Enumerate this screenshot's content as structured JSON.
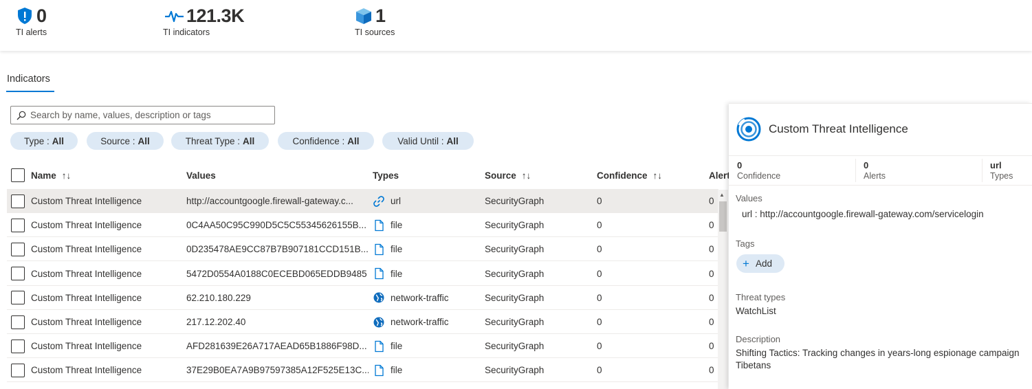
{
  "metrics": {
    "alerts": {
      "value": "0",
      "label": "TI alerts",
      "icon": "shield-alert-icon"
    },
    "indicators": {
      "value": "121.3K",
      "label": "TI indicators",
      "icon": "pulse-icon"
    },
    "sources": {
      "value": "1",
      "label": "TI sources",
      "icon": "cube-icon"
    }
  },
  "tab": {
    "label": "Indicators"
  },
  "search": {
    "placeholder": "Search by name, values, description or tags"
  },
  "filters": [
    {
      "label": "Type :",
      "value": "All"
    },
    {
      "label": "Source :",
      "value": "All"
    },
    {
      "label": "Threat Type :",
      "value": "All"
    },
    {
      "label": "Confidence :",
      "value": "All"
    },
    {
      "label": "Valid Until :",
      "value": "All"
    }
  ],
  "columns": {
    "name": "Name",
    "values": "Values",
    "types": "Types",
    "source": "Source",
    "confidence": "Confidence",
    "alerts": "Alert",
    "sort_glyph": "↑↓"
  },
  "rows": [
    {
      "name": "Custom Threat Intelligence",
      "values": "http://accountgoogle.firewall-gateway.c...",
      "type": "url",
      "type_icon": "link-icon",
      "source": "SecurityGraph",
      "confidence": "0",
      "alerts": "0",
      "selected": true
    },
    {
      "name": "Custom Threat Intelligence",
      "values": "0C4AA50C95C990D5C5C55345626155B...",
      "type": "file",
      "type_icon": "file-icon",
      "source": "SecurityGraph",
      "confidence": "0",
      "alerts": "0"
    },
    {
      "name": "Custom Threat Intelligence",
      "values": "0D235478AE9CC87B7B907181CCD151B...",
      "type": "file",
      "type_icon": "file-icon",
      "source": "SecurityGraph",
      "confidence": "0",
      "alerts": "0"
    },
    {
      "name": "Custom Threat Intelligence",
      "values": "5472D0554A0188C0ECEBD065EDDB9485",
      "type": "file",
      "type_icon": "file-icon",
      "source": "SecurityGraph",
      "confidence": "0",
      "alerts": "0"
    },
    {
      "name": "Custom Threat Intelligence",
      "values": "62.210.180.229",
      "type": "network-traffic",
      "type_icon": "globe-icon",
      "source": "SecurityGraph",
      "confidence": "0",
      "alerts": "0"
    },
    {
      "name": "Custom Threat Intelligence",
      "values": "217.12.202.40",
      "type": "network-traffic",
      "type_icon": "globe-icon",
      "source": "SecurityGraph",
      "confidence": "0",
      "alerts": "0"
    },
    {
      "name": "Custom Threat Intelligence",
      "values": "AFD281639E26A717AEAD65B1886F98D...",
      "type": "file",
      "type_icon": "file-icon",
      "source": "SecurityGraph",
      "confidence": "0",
      "alerts": "0"
    },
    {
      "name": "Custom Threat Intelligence",
      "values": "37E29B0EA7A9B97597385A12F525E13C...",
      "type": "file",
      "type_icon": "file-icon",
      "source": "SecurityGraph",
      "confidence": "0",
      "alerts": "0"
    }
  ],
  "details": {
    "title": "Custom Threat Intelligence",
    "stats": [
      {
        "value": "0",
        "label": "Confidence"
      },
      {
        "value": "0",
        "label": "Alerts"
      },
      {
        "value": "url",
        "label": "Types"
      }
    ],
    "values_label": "Values",
    "values_text": "url :  http://accountgoogle.firewall-gateway.com/servicelogin",
    "tags_label": "Tags",
    "add_label": "Add",
    "threat_types_label": "Threat types",
    "threat_types_value": "WatchList",
    "description_label": "Description",
    "description_line1": "Shifting Tactics: Tracking changes in years-long espionage campaign",
    "description_line2": "Tibetans"
  },
  "colors": {
    "accent": "#0078d4",
    "pill_bg": "#dde9f5",
    "selected_row": "#edebe9"
  }
}
